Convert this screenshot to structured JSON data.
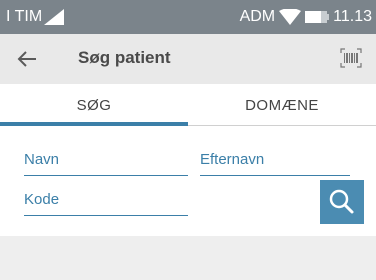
{
  "status_bar": {
    "carrier": "I TIM",
    "operator": "ADM",
    "time": "11.13"
  },
  "app_bar": {
    "title": "Søg patient",
    "back_icon": "arrow-left-icon",
    "barcode_icon": "barcode-scanner-icon"
  },
  "tabs": [
    {
      "label": "SØG",
      "active": true
    },
    {
      "label": "DOMÆNE",
      "active": false
    }
  ],
  "form": {
    "first_name_placeholder": "Navn",
    "last_name_placeholder": "Efternavn",
    "code_placeholder": "Kode",
    "search_icon": "search-icon"
  },
  "colors": {
    "status_bar": "#7b848b",
    "app_bar": "#e9e9e9",
    "accent": "#3b7fa8",
    "button": "#4b8cb2"
  }
}
